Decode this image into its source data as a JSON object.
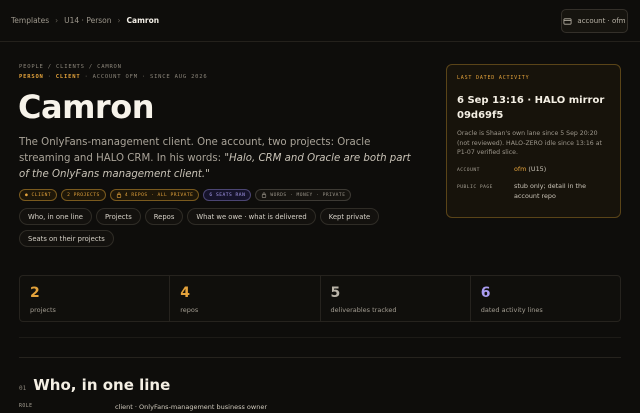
{
  "breadcrumb": [
    "Templates",
    "U14 · Person",
    "Camron"
  ],
  "account_button": {
    "label": "account · ofm",
    "icon": "card-icon"
  },
  "eyebrow": "PEOPLE / CLIENTS / CAMRON",
  "meta": {
    "type": "PERSON",
    "role": "CLIENT",
    "account": "ACCOUNT OFM",
    "since": "SINCE AUG 2026"
  },
  "title": "Camron",
  "description": {
    "text": "The OnlyFans-management client. One account, two projects: Oracle streaming and HALO CRM. In his words: ",
    "quote": "\"Halo, CRM and Oracle are both part of the OnlyFans management client.\""
  },
  "badges": [
    "● CLIENT",
    "2 PROJECTS",
    "4 REPOS · ALL PRIVATE",
    "6 SEATS RAN",
    "WORDS · MONEY · PRIVATE"
  ],
  "chips": [
    "Who, in one line",
    "Projects",
    "Repos",
    "What we owe · what is delivered",
    "Kept private",
    "Seats on their projects"
  ],
  "activity": {
    "heading": "LAST DATED ACTIVITY",
    "title": "6 Sep 13:16 · HALO mirror 09d69f5",
    "body": "Oracle is Shaan's own lane since 5 Sep 20:20 (not reviewed). HALO-ZERO idle since 13:16 at P1-07 verified slice.",
    "account_label": "ACCOUNT",
    "account_value": "ofm",
    "account_suffix": " (U15)",
    "public_label": "PUBLIC PAGE",
    "public_value": "stub only; detail in the account repo"
  },
  "stats": [
    {
      "num": "2",
      "label": "projects",
      "color": "#e3a23b"
    },
    {
      "num": "4",
      "label": "repos",
      "color": "#e3a23b"
    },
    {
      "num": "5",
      "label": "deliverables tracked",
      "color": "#b9b3a7"
    },
    {
      "num": "6",
      "label": "dated activity lines",
      "color": "#a99cf0"
    }
  ],
  "section": {
    "num": "01",
    "title": "Who, in one line"
  },
  "role": {
    "label": "ROLE",
    "value": "client · OnlyFans-management business owner"
  }
}
